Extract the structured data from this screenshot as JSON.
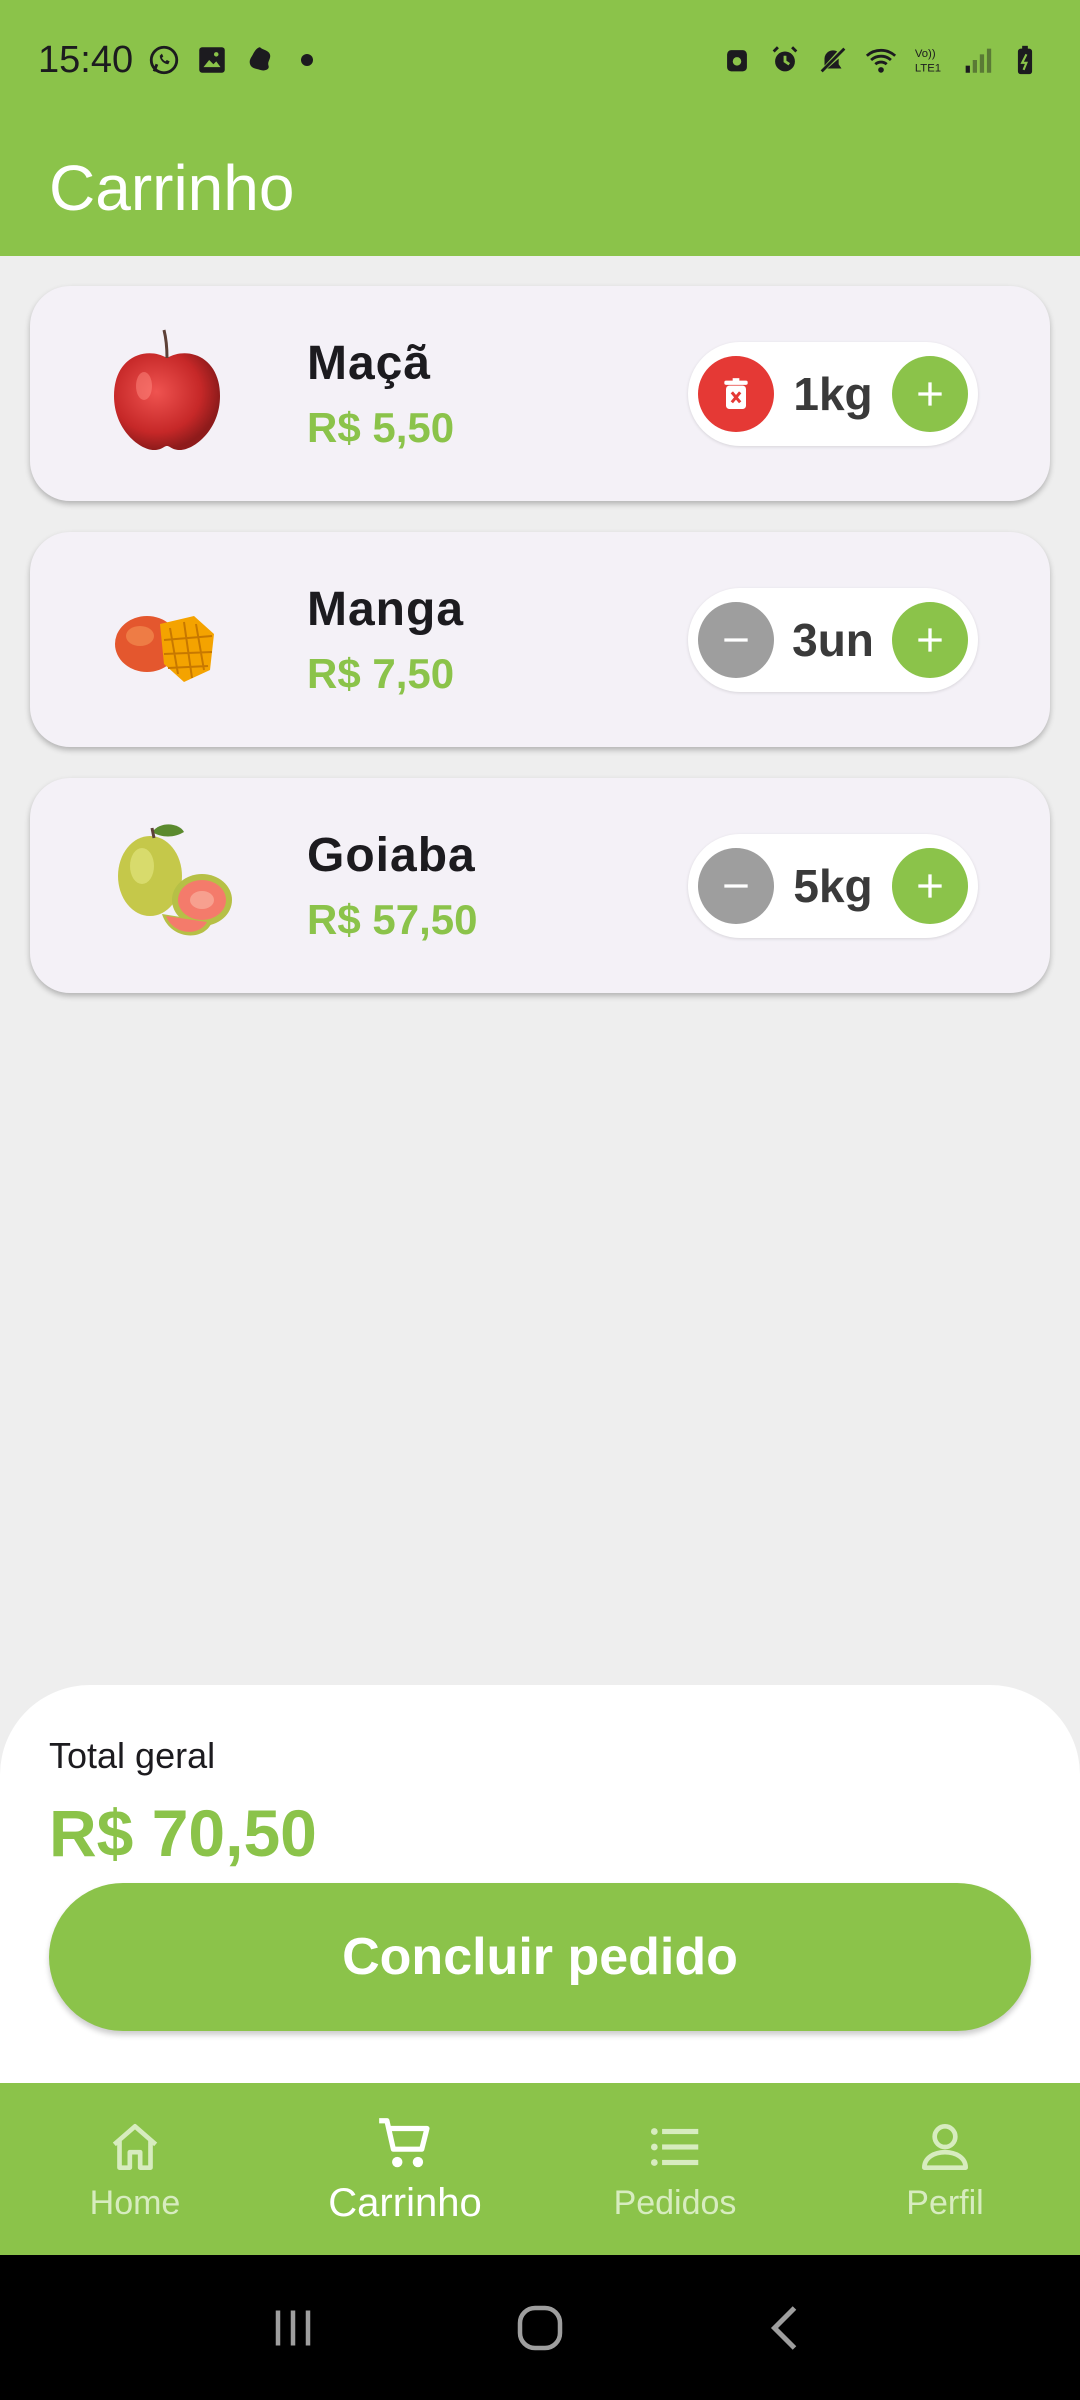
{
  "status_bar": {
    "time": "15:40",
    "left_icons": [
      "whatsapp-icon",
      "gallery-icon",
      "app-notification-icon",
      "dot-icon"
    ],
    "right_icons": [
      "android-icon",
      "alarm-icon",
      "mute-icon",
      "wifi-icon",
      "volte-icon",
      "signal-icon",
      "battery-icon"
    ],
    "volte_text": "Vo)) LTE1"
  },
  "app_bar": {
    "title": "Carrinho"
  },
  "cart": {
    "items": [
      {
        "name": "Maçã",
        "price": "R$ 5,50",
        "quantity": "1kg",
        "image": "apple",
        "left_action": "delete"
      },
      {
        "name": "Manga",
        "price": "R$ 7,50",
        "quantity": "3un",
        "image": "mango",
        "left_action": "remove"
      },
      {
        "name": "Goiaba",
        "price": "R$ 57,50",
        "quantity": "5kg",
        "image": "guava",
        "left_action": "remove"
      }
    ]
  },
  "summary": {
    "total_label": "Total geral",
    "total_value": "R$ 70,50",
    "checkout_label": "Concluir pedido"
  },
  "bottom_nav": {
    "items": [
      {
        "label": "Home",
        "icon": "home-icon",
        "active": false
      },
      {
        "label": "Carrinho",
        "icon": "cart-icon",
        "active": true
      },
      {
        "label": "Pedidos",
        "icon": "list-icon",
        "active": false
      },
      {
        "label": "Perfil",
        "icon": "person-icon",
        "active": false
      }
    ]
  },
  "colors": {
    "primary": "#8bc34a",
    "delete": "#e53935",
    "neutral_button": "#9e9e9e",
    "card": "#f4f1f7",
    "background": "#eeeeee"
  }
}
